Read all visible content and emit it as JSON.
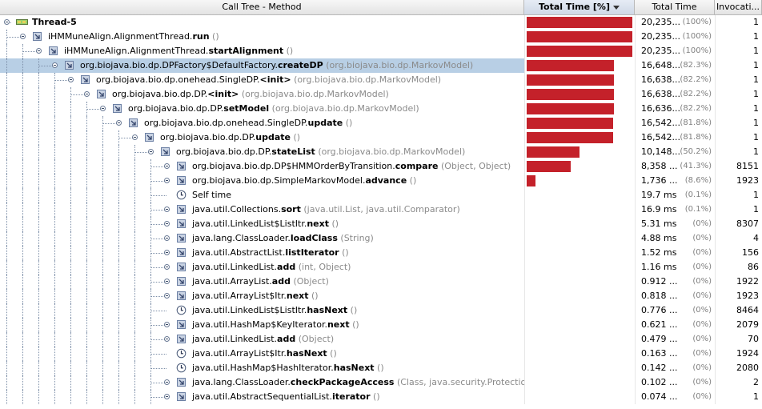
{
  "header": {
    "method": "Call Tree - Method",
    "total_percent": "Total Time [%]",
    "total_time": "Total Time",
    "invocations": "Invocati..."
  },
  "colors": {
    "bar": "#c4212a",
    "selection": "#b8cfe5"
  },
  "rows": [
    {
      "depth": 0,
      "kind": "thread",
      "name": "Thread-5",
      "bold": "",
      "params": "",
      "cls": "",
      "pct": 100,
      "time": "20,235...",
      "pctText": "(100%)",
      "inv": "1"
    },
    {
      "depth": 1,
      "kind": "method",
      "name": "iHMMuneAlign.AlignmentThread.",
      "bold": "run",
      "params": " ()",
      "cls": "",
      "pct": 100,
      "time": "20,235...",
      "pctText": "(100%)",
      "inv": "1"
    },
    {
      "depth": 2,
      "kind": "method",
      "name": "iHMMuneAlign.AlignmentThread.",
      "bold": "startAlignment",
      "params": " ()",
      "cls": "",
      "pct": 100,
      "time": "20,235...",
      "pctText": "(100%)",
      "inv": "1"
    },
    {
      "depth": 3,
      "kind": "method",
      "name": "org.biojava.bio.dp.DPFactory$DefaultFactory.",
      "bold": "createDP",
      "params": "",
      "cls": " (org.biojava.bio.dp.MarkovModel)",
      "pct": 82.3,
      "time": "16,648...",
      "pctText": "(82.3%)",
      "inv": "1",
      "selected": true
    },
    {
      "depth": 4,
      "kind": "method",
      "name": "org.biojava.bio.dp.onehead.SingleDP.",
      "bold": "<init>",
      "params": "",
      "cls": " (org.biojava.bio.dp.MarkovModel)",
      "pct": 82.2,
      "time": "16,638...",
      "pctText": "(82.2%)",
      "inv": "1"
    },
    {
      "depth": 5,
      "kind": "method",
      "name": "org.biojava.bio.dp.DP.",
      "bold": "<init>",
      "params": "",
      "cls": " (org.biojava.bio.dp.MarkovModel)",
      "pct": 82.2,
      "time": "16,638...",
      "pctText": "(82.2%)",
      "inv": "1"
    },
    {
      "depth": 6,
      "kind": "method",
      "name": "org.biojava.bio.dp.DP.",
      "bold": "setModel",
      "params": "",
      "cls": " (org.biojava.bio.dp.MarkovModel)",
      "pct": 82.2,
      "time": "16,636...",
      "pctText": "(82.2%)",
      "inv": "1"
    },
    {
      "depth": 7,
      "kind": "method",
      "name": "org.biojava.bio.dp.onehead.SingleDP.",
      "bold": "update",
      "params": " ()",
      "cls": "",
      "pct": 81.8,
      "time": "16,542...",
      "pctText": "(81.8%)",
      "inv": "1"
    },
    {
      "depth": 8,
      "kind": "method",
      "name": "org.biojava.bio.dp.DP.",
      "bold": "update",
      "params": " ()",
      "cls": "",
      "pct": 81.8,
      "time": "16,542...",
      "pctText": "(81.8%)",
      "inv": "1"
    },
    {
      "depth": 9,
      "kind": "method",
      "name": "org.biojava.bio.dp.DP.",
      "bold": "stateList",
      "params": "",
      "cls": " (org.biojava.bio.dp.MarkovModel)",
      "pct": 50.2,
      "time": "10,148...",
      "pctText": "(50.2%)",
      "inv": "1"
    },
    {
      "depth": 10,
      "kind": "method",
      "name": "org.biojava.bio.dp.DP$HMMOrderByTransition.",
      "bold": "compare",
      "params": " (Object, Object)",
      "cls": "",
      "pct": 41.3,
      "time": "8,358 ...",
      "pctText": "(41.3%)",
      "inv": "8151"
    },
    {
      "depth": 10,
      "kind": "method",
      "name": "org.biojava.bio.dp.SimpleMarkovModel.",
      "bold": "advance",
      "params": " ()",
      "cls": "",
      "pct": 8.6,
      "time": "1,736 ...",
      "pctText": "(8.6%)",
      "inv": "1923"
    },
    {
      "depth": 10,
      "kind": "self",
      "name": "Self time",
      "bold": "",
      "params": "",
      "cls": "",
      "pct": 0.1,
      "time": "19.7 ms",
      "pctText": "(0.1%)",
      "inv": "1"
    },
    {
      "depth": 10,
      "kind": "method",
      "name": "java.util.Collections.",
      "bold": "sort",
      "params": " (java.util.List, java.util.Comparator)",
      "cls": "",
      "pct": 0.1,
      "time": "16.9 ms",
      "pctText": "(0.1%)",
      "inv": "1"
    },
    {
      "depth": 10,
      "kind": "method",
      "name": "java.util.LinkedList$ListItr.",
      "bold": "next",
      "params": " ()",
      "cls": "",
      "pct": 0,
      "time": "5.31 ms",
      "pctText": "(0%)",
      "inv": "8307"
    },
    {
      "depth": 10,
      "kind": "method",
      "name": "java.lang.ClassLoader.",
      "bold": "loadClass",
      "params": " (String)",
      "cls": "",
      "pct": 0,
      "time": "4.88 ms",
      "pctText": "(0%)",
      "inv": "4"
    },
    {
      "depth": 10,
      "kind": "method",
      "name": "java.util.AbstractList.",
      "bold": "listIterator",
      "params": " ()",
      "cls": "",
      "pct": 0,
      "time": "1.52 ms",
      "pctText": "(0%)",
      "inv": "156"
    },
    {
      "depth": 10,
      "kind": "method",
      "name": "java.util.LinkedList.",
      "bold": "add",
      "params": " (int, Object)",
      "cls": "",
      "pct": 0,
      "time": "1.16 ms",
      "pctText": "(0%)",
      "inv": "86"
    },
    {
      "depth": 10,
      "kind": "method",
      "name": "java.util.ArrayList.",
      "bold": "add",
      "params": " (Object)",
      "cls": "",
      "pct": 0,
      "time": "0.912 ...",
      "pctText": "(0%)",
      "inv": "1922"
    },
    {
      "depth": 10,
      "kind": "method",
      "name": "java.util.ArrayList$Itr.",
      "bold": "next",
      "params": " ()",
      "cls": "",
      "pct": 0,
      "time": "0.818 ...",
      "pctText": "(0%)",
      "inv": "1923"
    },
    {
      "depth": 10,
      "kind": "leaf",
      "name": "java.util.LinkedList$ListItr.",
      "bold": "hasNext",
      "params": " ()",
      "cls": "",
      "pct": 0,
      "time": "0.776 ...",
      "pctText": "(0%)",
      "inv": "8464"
    },
    {
      "depth": 10,
      "kind": "method",
      "name": "java.util.HashMap$KeyIterator.",
      "bold": "next",
      "params": " ()",
      "cls": "",
      "pct": 0,
      "time": "0.621 ...",
      "pctText": "(0%)",
      "inv": "2079"
    },
    {
      "depth": 10,
      "kind": "method",
      "name": "java.util.LinkedList.",
      "bold": "add",
      "params": " (Object)",
      "cls": "",
      "pct": 0,
      "time": "0.479 ...",
      "pctText": "(0%)",
      "inv": "70"
    },
    {
      "depth": 10,
      "kind": "leaf",
      "name": "java.util.ArrayList$Itr.",
      "bold": "hasNext",
      "params": " ()",
      "cls": "",
      "pct": 0,
      "time": "0.163 ...",
      "pctText": "(0%)",
      "inv": "1924"
    },
    {
      "depth": 10,
      "kind": "leaf",
      "name": "java.util.HashMap$HashIterator.",
      "bold": "hasNext",
      "params": " ()",
      "cls": "",
      "pct": 0,
      "time": "0.142 ...",
      "pctText": "(0%)",
      "inv": "2080"
    },
    {
      "depth": 10,
      "kind": "method",
      "name": "java.lang.ClassLoader.",
      "bold": "checkPackageAccess",
      "params": " (Class, java.security.ProtectionDomain)",
      "cls": "",
      "pct": 0,
      "time": "0.102 ...",
      "pctText": "(0%)",
      "inv": "2"
    },
    {
      "depth": 10,
      "kind": "method",
      "name": "java.util.AbstractSequentialList.",
      "bold": "iterator",
      "params": " ()",
      "cls": "",
      "pct": 0,
      "time": "0.074 ...",
      "pctText": "(0%)",
      "inv": "1"
    }
  ]
}
